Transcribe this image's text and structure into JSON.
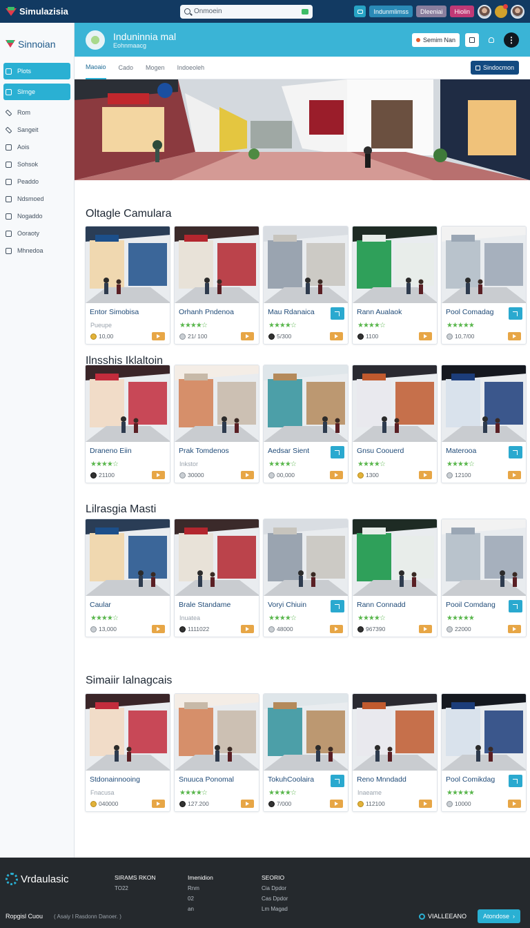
{
  "app": {
    "title": "Simulazisia"
  },
  "search": {
    "placeholder": "Onmoein"
  },
  "topbar": {
    "btn1": "Indunmlimss",
    "btn2": "Dleeniai",
    "btn3": "Hiolin"
  },
  "sidebar": {
    "brand": "Sinnoian",
    "items": [
      {
        "label": "Plots",
        "icon": "grid-icon",
        "active": true
      },
      {
        "label": "Slrnge",
        "icon": "grid-icon",
        "active": true
      },
      {
        "label": "Rom",
        "icon": "pen-icon"
      },
      {
        "label": "Sangeit",
        "icon": "pen-icon"
      },
      {
        "label": "Aois",
        "icon": "checkbox-icon"
      },
      {
        "label": "Sohsok",
        "icon": "checkbox-icon"
      },
      {
        "label": "Peaddo",
        "icon": "checkbox-icon"
      },
      {
        "label": "Ndsmoed",
        "icon": "checkbox-icon"
      },
      {
        "label": "Nogaddo",
        "icon": "checkbox-icon"
      },
      {
        "label": "Ooraoty",
        "icon": "checkbox-icon"
      },
      {
        "label": "Mhnedoa",
        "icon": "checkbox-icon"
      }
    ]
  },
  "header": {
    "title": "Induninnia mal",
    "subtitle": "Eohnmaacg",
    "action_label": "Semim Nan"
  },
  "tabs": [
    "Maoaio",
    "Cado",
    "Mogen",
    "Indoeoleh"
  ],
  "tab_cta": "Sindocmon",
  "sections": [
    {
      "title": "Oltagle Camulara",
      "cards": [
        {
          "name": "Entor Simobisa",
          "sub": "Pueupe",
          "meta": "10,00",
          "coin": "gold"
        },
        {
          "name": "Orhanh Pndenoa",
          "stars": "★★★★☆",
          "meta": "21/ 100",
          "coin": "grey"
        },
        {
          "name": "Mau Rdanaica",
          "stars": "★★★★☆",
          "meta": "5/300",
          "coin": "dark",
          "share": true
        },
        {
          "name": "Rann Aualaok",
          "stars": "★★★★☆",
          "meta": "1100",
          "coin": "dark"
        },
        {
          "name": "Pool Comadag",
          "stars": "★★★★★",
          "meta": "10,7/00",
          "coin": "grey",
          "share": true
        }
      ]
    },
    {
      "title": "Ilnsshis Iklaltoin",
      "cards": [
        {
          "name": "Draneno Eiin",
          "stars": "★★★★☆",
          "meta": "21100",
          "coin": "dark"
        },
        {
          "name": "Prak Tomdenos",
          "sub": "Inkstor",
          "meta": "30000",
          "coin": "grey"
        },
        {
          "name": "Aedsar Sient",
          "stars": "★★★★☆",
          "meta": "00,000",
          "coin": "grey",
          "share": true
        },
        {
          "name": "Gnsu Coouerd",
          "stars": "★★★★☆",
          "meta": "1300",
          "coin": "gold"
        },
        {
          "name": "Materooa",
          "stars": "★★★★☆",
          "meta": "12100",
          "coin": "grey",
          "share": true
        }
      ]
    },
    {
      "title": "Lilrasgia Masti",
      "cards": [
        {
          "name": "Caular",
          "stars": "★★★★☆",
          "meta": "13,000",
          "coin": "grey"
        },
        {
          "name": "Brale Standame",
          "sub": "Inuatea",
          "meta": "1111022",
          "coin": "dark"
        },
        {
          "name": "Voryi Chiuin",
          "stars": "★★★★☆",
          "meta": "48000",
          "coin": "grey",
          "share": true
        },
        {
          "name": "Rann Connadd",
          "stars": "★★★★☆",
          "meta": "967390",
          "coin": "dark"
        },
        {
          "name": "Pooil Comdang",
          "stars": "★★★★★",
          "meta": "22000",
          "coin": "grey",
          "share": true
        }
      ]
    },
    {
      "title": "Simaiir Ialnagcais",
      "cards": [
        {
          "name": "Stdonainnooing",
          "sub": "Fnacusa",
          "meta": "040000",
          "coin": "gold"
        },
        {
          "name": "Snuuca Ponomal",
          "stars": "★★★★☆",
          "meta": "127.200",
          "coin": "dark"
        },
        {
          "name": "TokuhCoolaira",
          "stars": "★★★★☆",
          "meta": "7/000",
          "coin": "dark",
          "share": true
        },
        {
          "name": "Reno Mnndadd",
          "sub": "Inaeame",
          "meta": "112100",
          "coin": "gold"
        },
        {
          "name": "Pool Comikdag",
          "stars": "★★★★★",
          "meta": "10000",
          "coin": "grey",
          "share": true
        }
      ]
    }
  ],
  "footer": {
    "brand": "Vrdaulasic",
    "col1": {
      "heading": "SIRAMS RKON",
      "lines": [
        "TO22"
      ]
    },
    "col2": {
      "heading": "Imenidion",
      "lines": [
        "Rnm",
        "02",
        "an"
      ]
    },
    "col3": {
      "heading": "SEORIO",
      "lines": [
        "Cia Dpdor",
        "Cas Dpdor",
        "Lm Magad"
      ]
    },
    "bottom_brand": "Ropgisl Cuou",
    "bottom_note": "( Asaiy I Rasdonn Danoer. )",
    "status_label": "VIALLEEANO",
    "cta_label": "Atondose"
  },
  "colors": {
    "accent": "#2ab0d3",
    "topbar": "#123a62",
    "star": "#59b64c",
    "go": "#e7a646"
  }
}
